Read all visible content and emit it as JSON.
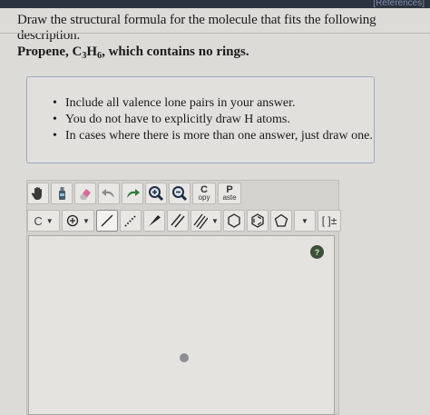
{
  "header": {
    "references_link": "[References]"
  },
  "question": {
    "prompt": "Draw the structural formula for the molecule that fits the following description.",
    "molecule_name": "Propene, C",
    "sub1": "3",
    "mid": "H",
    "sub2": "6",
    "tail": ", which contains no rings."
  },
  "instructions": [
    "Include all valence lone pairs in your answer.",
    "You do not have to explicitly draw H atoms.",
    "In cases where there is more than one answer, just draw one."
  ],
  "toolbar": {
    "copy_top": "C",
    "copy_bottom": "opy",
    "paste_top": "P",
    "paste_bottom": "aste",
    "element_label": "C",
    "bracket_label": "[ ]±"
  },
  "canvas": {
    "help_label": "?"
  },
  "colors": {
    "topbar": "#2c3340",
    "help": "#3c4f3a",
    "eraser": "#d66a9c",
    "redo": "#2f7a3a"
  }
}
